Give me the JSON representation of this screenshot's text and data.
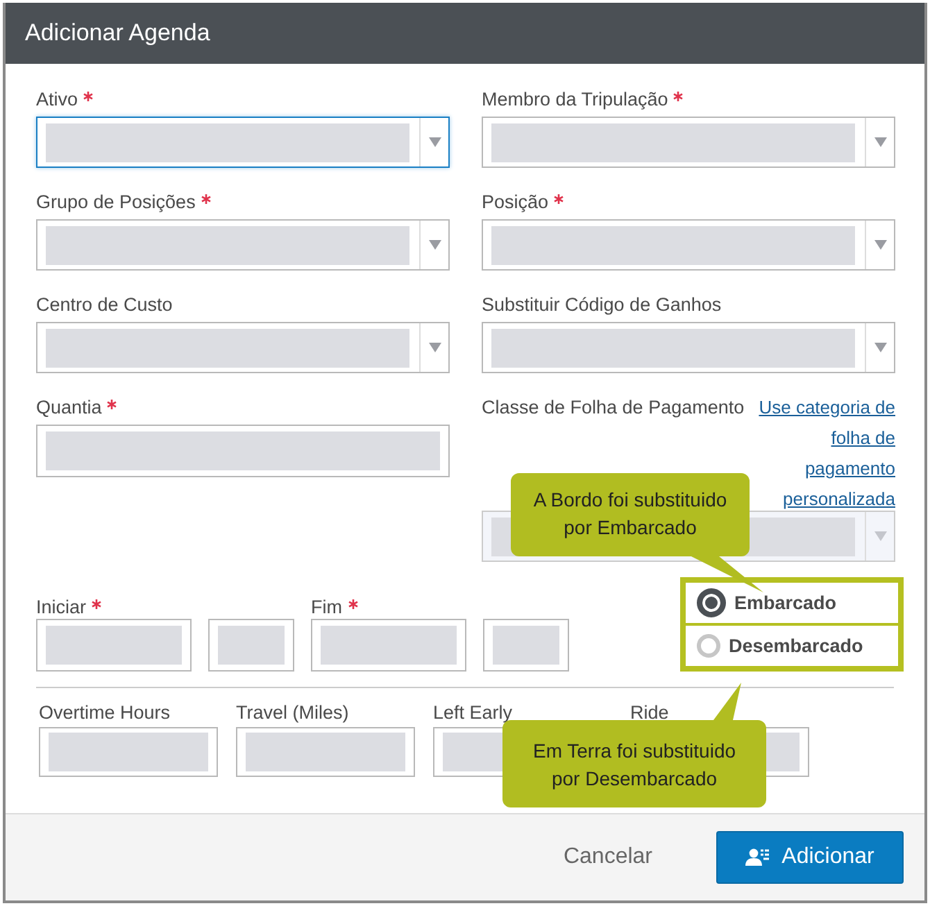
{
  "dialog": {
    "title": "Adicionar Agenda"
  },
  "fields": [
    {
      "label": "Ativo",
      "required": true,
      "focused": true,
      "disabled": false
    },
    {
      "label": "Membro da Tripulação",
      "required": true,
      "focused": false,
      "disabled": false
    },
    {
      "label": "Grupo de Posições",
      "required": true,
      "focused": false,
      "disabled": false
    },
    {
      "label": "Posição",
      "required": true,
      "focused": false,
      "disabled": false
    },
    {
      "label": "Centro de Custo",
      "required": false,
      "focused": false,
      "disabled": false
    },
    {
      "label": "Substituir Código de Ganhos",
      "required": false,
      "focused": false,
      "disabled": false
    }
  ],
  "quantity": {
    "label": "Quantia",
    "required": true
  },
  "payroll_class": {
    "label": "Classe de Folha de Pagamento",
    "link": "Use categoria de folha de pagamento personalizada",
    "disabled": true
  },
  "date_fields": [
    {
      "label": "Iniciar",
      "required": true
    },
    {
      "label": "Fim",
      "required": true
    }
  ],
  "location_options": [
    {
      "label": "Embarcado",
      "selected": true
    },
    {
      "label": "Desembarcado",
      "selected": false
    }
  ],
  "extra_fields": [
    {
      "label": "Overtime Hours"
    },
    {
      "label": "Travel (Miles)"
    },
    {
      "label": "Left Early"
    },
    {
      "label": "Ride"
    }
  ],
  "callouts": [
    {
      "text": "A Bordo foi substituido por Embarcado",
      "kind": "below"
    },
    {
      "text": "Em Terra foi substituido por Desembarcado",
      "kind": "above"
    }
  ],
  "buttons": [
    {
      "label": "Cancelar",
      "kind": "secondary"
    },
    {
      "label": "Adicionar",
      "kind": "primary"
    }
  ]
}
